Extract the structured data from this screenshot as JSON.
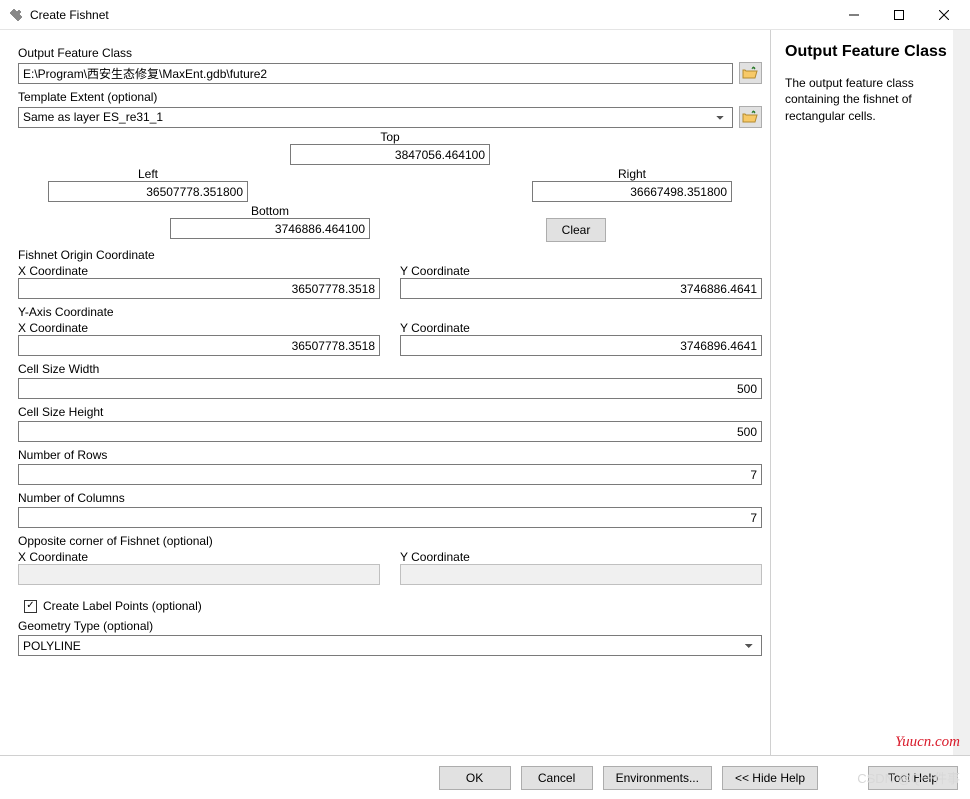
{
  "window": {
    "title": "Create Fishnet"
  },
  "output_feature_class": {
    "label": "Output Feature Class",
    "value": "E:\\Program\\西安生态修复\\MaxEnt.gdb\\future2"
  },
  "template_extent": {
    "label": "Template Extent (optional)",
    "value": "Same as layer ES_re31_1"
  },
  "extent": {
    "top_label": "Top",
    "top": "3847056.464100",
    "left_label": "Left",
    "left": "36507778.351800",
    "right_label": "Right",
    "right": "36667498.351800",
    "bottom_label": "Bottom",
    "bottom": "3746886.464100",
    "clear": "Clear"
  },
  "origin": {
    "section": "Fishnet Origin Coordinate",
    "x_label": "X Coordinate",
    "x": "36507778.3518",
    "y_label": "Y Coordinate",
    "y": "3746886.4641"
  },
  "yaxis": {
    "section": "Y-Axis Coordinate",
    "x_label": "X Coordinate",
    "x": "36507778.3518",
    "y_label": "Y Coordinate",
    "y": "3746896.4641"
  },
  "cell_width": {
    "label": "Cell Size Width",
    "value": "500"
  },
  "cell_height": {
    "label": "Cell Size Height",
    "value": "500"
  },
  "num_rows": {
    "label": "Number of Rows",
    "value": "7"
  },
  "num_cols": {
    "label": "Number of Columns",
    "value": "7"
  },
  "opposite": {
    "section": "Opposite corner of Fishnet (optional)",
    "x_label": "X Coordinate",
    "x": "",
    "y_label": "Y Coordinate",
    "y": ""
  },
  "labels_chk": {
    "label": "Create Label Points (optional)",
    "checked": true
  },
  "geometry": {
    "label": "Geometry Type (optional)",
    "value": "POLYLINE"
  },
  "help": {
    "title": "Output Feature Class",
    "body": "The output feature class containing the fishnet of rectangular cells."
  },
  "footer": {
    "ok": "OK",
    "cancel": "Cancel",
    "env": "Environments...",
    "hide": "<< Hide Help",
    "toolhelp": "Tool Help"
  },
  "watermark1": "Yuucn.com",
  "watermark2": "CSDN @Q一件事"
}
